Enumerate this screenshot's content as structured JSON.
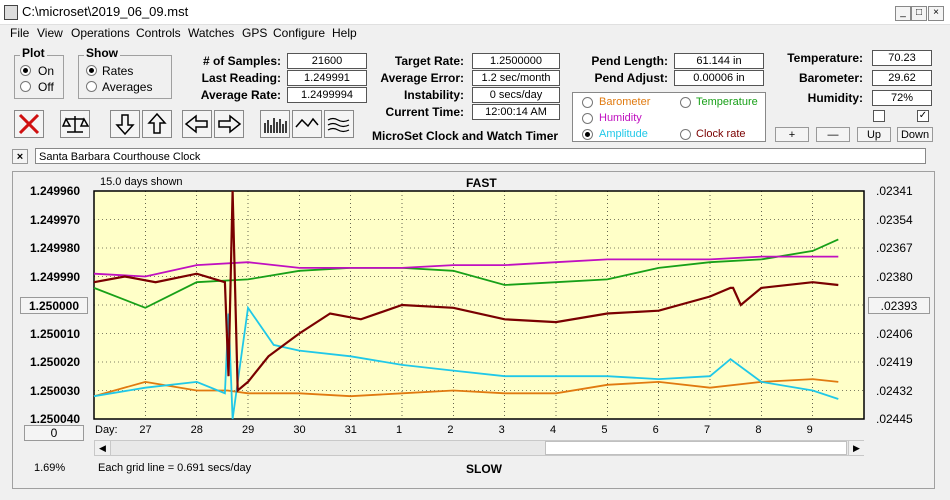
{
  "window": {
    "title": "C:\\microset\\2019_06_09.mst",
    "min_icon": "minimize-icon",
    "max_icon": "maximize-icon",
    "close_icon": "close-icon"
  },
  "menu": [
    "File",
    "View",
    "Operations",
    "Controls",
    "Watches",
    "GPS",
    "Configure",
    "Help"
  ],
  "plot_group": {
    "label": "Plot",
    "options": [
      "On",
      "Off"
    ],
    "selected": "On"
  },
  "show_group": {
    "label": "Show",
    "options": [
      "Rates",
      "Averages"
    ],
    "selected": "Rates"
  },
  "stats": {
    "samples_label": "# of Samples:",
    "samples": "21600",
    "last_label": "Last Reading:",
    "last": "1.249991",
    "avg_rate_label": "Average Rate:",
    "avg_rate": "1.2499994",
    "target_label": "Target Rate:",
    "target": "1.2500000",
    "avg_err_label": "Average Error:",
    "avg_err": "1.2 sec/month",
    "instab_label": "Instability:",
    "instab": "0 secs/day",
    "time_label": "Current Time:",
    "time": "12:00:14 AM",
    "pend_len_label": "Pend Length:",
    "pend_len": "61.144 in",
    "pend_adj_label": "Pend Adjust:",
    "pend_adj": "0.00006 in",
    "temp_label": "Temperature:",
    "temp": "70.23",
    "baro_label": "Barometer:",
    "baro": "29.62",
    "hum_label": "Humidity:",
    "hum": "72%"
  },
  "app_caption": "MicroSet Clock and Watch Timer",
  "series_select": {
    "options": [
      {
        "label": "Barometer",
        "color": "#e07a10",
        "selected": false
      },
      {
        "label": "Temperature",
        "color": "#18a018",
        "selected": false
      },
      {
        "label": "Humidity",
        "color": "#c010c0",
        "selected": false
      },
      {
        "label": "Amplitude",
        "color": "#20c8e8",
        "selected": true
      },
      {
        "label": "Clock rate",
        "color": "#7a0000",
        "selected": false
      }
    ]
  },
  "right_buttons": [
    "+",
    "—",
    "Up",
    "Down"
  ],
  "checkbox2_checked": true,
  "toolbar_icons": [
    "stop-icon",
    "balance-icon",
    "arrow-down-icon",
    "arrow-up-icon",
    "arrow-left-icon",
    "arrow-right-icon",
    "bars-icon",
    "wave-icon",
    "multiwave-icon"
  ],
  "description_close": "×",
  "description": "Santa Barbara Courthouse Clock",
  "chart": {
    "days_shown": "15.0 days shown",
    "top_label": "FAST",
    "bottom_label": "SLOW",
    "zero_button": "0",
    "left_button": "1.250000",
    "right_button": ".02393",
    "percent": "1.69%",
    "grid_note": "Each grid line = 0.691 secs/day",
    "day_label": "Day:"
  },
  "chart_data": {
    "type": "line",
    "title": "",
    "xlabel": "Day:",
    "y_ticks": [
      "1.249960",
      "1.249970",
      "1.249980",
      "1.249990",
      "1.250000",
      "1.250010",
      "1.250020",
      "1.250030",
      "1.250040"
    ],
    "y_reversed": true,
    "ylim": [
      1.24996,
      1.25004
    ],
    "right_ticks": [
      ".02341",
      ".02354",
      ".02367",
      ".02380",
      ".02393",
      ".02406",
      ".02419",
      ".02432",
      ".02445"
    ],
    "x_ticks": [
      "27",
      "28",
      "29",
      "30",
      "31",
      "1",
      "2",
      "3",
      "4",
      "5",
      "6",
      "7",
      "8",
      "9"
    ],
    "grid": true,
    "series": [
      {
        "color": "#7a0000",
        "x": [
          0,
          0.6,
          1.2,
          2,
          2.55,
          2.62,
          2.7,
          2.8,
          3.0,
          3.4,
          4.0,
          4.6,
          5.2,
          6.0,
          7.0,
          8.0,
          9.0,
          10.0,
          11.0,
          12.0,
          12.4,
          12.45,
          12.6,
          13.0,
          14.0,
          14.5
        ],
        "values": [
          1.249992,
          1.24999,
          1.249992,
          1.249989,
          1.249992,
          1.250025,
          1.24996,
          1.25003,
          1.250027,
          1.250018,
          1.25001,
          1.250003,
          1.250005,
          1.25,
          1.250001,
          1.250005,
          1.250006,
          1.250003,
          1.250002,
          1.249997,
          1.249994,
          1.249994,
          1.25,
          1.249994,
          1.249992,
          1.249993
        ]
      },
      {
        "color": "#18a018",
        "x": [
          0,
          1,
          2,
          3,
          4,
          5,
          6,
          7,
          8,
          9,
          10,
          11,
          12,
          13,
          14,
          14.5
        ],
        "values": [
          1.249994,
          1.250001,
          1.249992,
          1.249991,
          1.249988,
          1.249987,
          1.249987,
          1.249988,
          1.249993,
          1.249992,
          1.249991,
          1.249987,
          1.249985,
          1.249984,
          1.249981,
          1.249977
        ]
      },
      {
        "color": "#c010c0",
        "x": [
          0,
          1,
          2,
          3,
          4,
          5,
          6,
          7,
          8,
          9,
          10,
          11,
          12,
          13,
          14,
          14.5
        ],
        "values": [
          1.249989,
          1.24999,
          1.249986,
          1.249985,
          1.249987,
          1.249987,
          1.249987,
          1.249986,
          1.249986,
          1.249985,
          1.249984,
          1.249984,
          1.249984,
          1.249983,
          1.249983,
          1.249983
        ]
      },
      {
        "color": "#20c8e8",
        "x": [
          0,
          1,
          2,
          2.55,
          2.62,
          2.7,
          3.0,
          3.5,
          4,
          5,
          6,
          7,
          8,
          9,
          10,
          11,
          12,
          12.4,
          13,
          14,
          14.5
        ],
        "values": [
          1.250032,
          1.250029,
          1.250027,
          1.250031,
          1.250003,
          1.25004,
          1.250001,
          1.250014,
          1.250016,
          1.250018,
          1.250021,
          1.250023,
          1.250025,
          1.250025,
          1.250025,
          1.250026,
          1.250025,
          1.250019,
          1.250027,
          1.25003,
          1.250033
        ]
      },
      {
        "color": "#e07a10",
        "x": [
          0,
          1,
          2,
          2.6,
          3,
          4,
          5,
          6,
          7,
          8,
          9,
          10,
          11,
          12,
          13,
          14,
          14.5
        ],
        "values": [
          1.250032,
          1.250027,
          1.25003,
          1.25003,
          1.250031,
          1.250031,
          1.250032,
          1.250031,
          1.25003,
          1.250031,
          1.250031,
          1.250028,
          1.250027,
          1.250029,
          1.250027,
          1.250026,
          1.250027
        ]
      }
    ]
  }
}
